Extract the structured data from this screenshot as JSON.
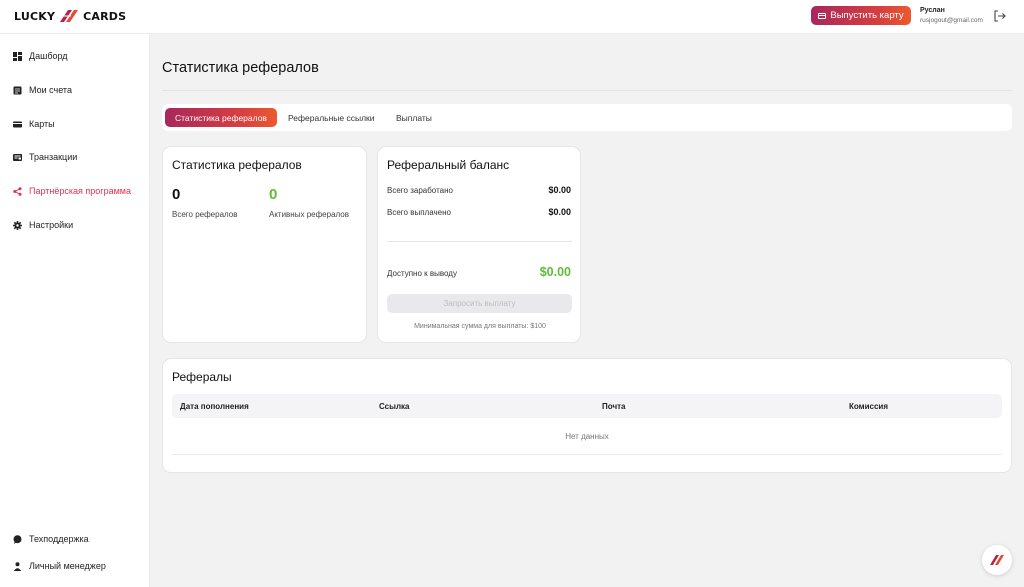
{
  "header": {
    "logo_left": "LUCKY",
    "logo_right": "CARDS",
    "issue_card_label": "Выпустить карту",
    "user_name": "Руслан",
    "user_email": "rusjogout@gmail.com"
  },
  "sidebar": {
    "items": [
      {
        "label": "Дашборд",
        "icon": "dashboard-icon"
      },
      {
        "label": "Мои счета",
        "icon": "accounts-icon"
      },
      {
        "label": "Карты",
        "icon": "card-icon"
      },
      {
        "label": "Транзакции",
        "icon": "transactions-icon"
      },
      {
        "label": "Партнёрская программа",
        "icon": "share-icon",
        "active": true
      },
      {
        "label": "Настройки",
        "icon": "gear-icon"
      }
    ],
    "bottom": [
      {
        "label": "Техподдержка",
        "icon": "chat-icon"
      },
      {
        "label": "Личный менеджер",
        "icon": "person-icon"
      }
    ]
  },
  "main": {
    "page_title": "Статистика рефералов",
    "tabs": [
      {
        "label": "Статистика рефералов",
        "active": true
      },
      {
        "label": "Реферальные ссылки"
      },
      {
        "label": "Выплаты"
      }
    ],
    "stats": {
      "title": "Статистика рефералов",
      "total_value": "0",
      "total_label": "Всего рефералов",
      "active_value": "0",
      "active_label": "Активных рефералов"
    },
    "balance": {
      "title": "Реферальный баланс",
      "earned_label": "Всего заработано",
      "earned_value": "$0.00",
      "paid_label": "Всего выплачено",
      "paid_value": "$0.00",
      "available_label": "Доступно к выводу",
      "available_value": "$0.00",
      "request_label": "Запросить выплату",
      "min_note": "Минимальная сумма для выплаты: $100"
    },
    "referrals": {
      "title": "Рефералы",
      "columns": [
        "Дата пополнения",
        "Ссылка",
        "Почта",
        "Комиссия"
      ],
      "empty": "Нет данных"
    }
  },
  "colors": {
    "accent_start": "#a8275c",
    "accent_end": "#ea5a2e",
    "active_nav": "#e0304d",
    "green": "#5cbf3a"
  }
}
